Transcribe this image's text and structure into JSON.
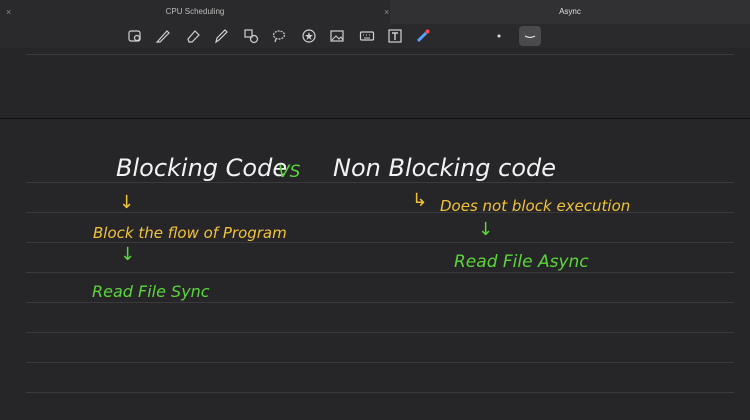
{
  "tabs": [
    {
      "label": "CPU Scheduling",
      "active": false
    },
    {
      "label": "Async",
      "active": true
    }
  ],
  "tab_close_glyph": "×",
  "toolbar": {
    "tools": [
      "lasso-icon",
      "pen-icon",
      "eraser-icon",
      "highlighter-icon",
      "shapes-icon",
      "lasso-select-icon",
      "sticker-icon",
      "image-icon",
      "keyboard-icon",
      "text-icon",
      "laser-pointer-icon"
    ],
    "pen_sizes": [
      "small-dot",
      "medium-stroke"
    ]
  },
  "colors": {
    "white_ink": "#f2f2f2",
    "green_ink": "#5ad63a",
    "yellow_ink": "#f2c23a",
    "background": "#262628"
  },
  "notes": {
    "blocking_code": "Blocking Code",
    "vs": "VS",
    "non_blocking_code": "Non Blocking code",
    "block_flow": "Block the flow of Program",
    "read_file_sync": "Read File Sync",
    "does_not_block": "Does not block execution",
    "read_file_async": "Read File Async",
    "arrow_down": "↓",
    "arrow_return": "↳"
  }
}
